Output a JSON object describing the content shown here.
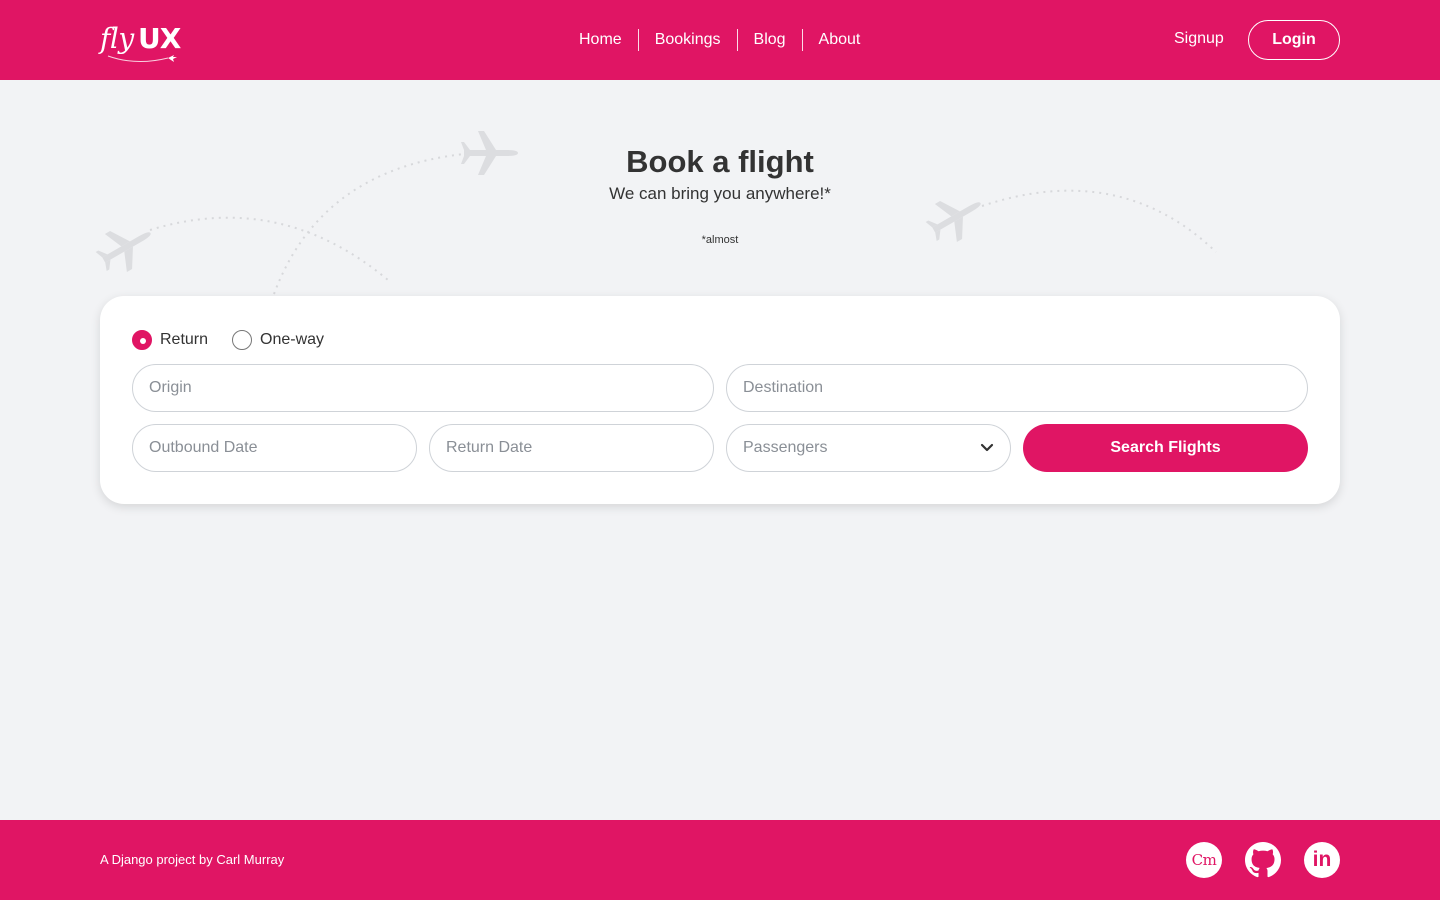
{
  "brand": {
    "logo_fly": "fly",
    "logo_ux": "UX",
    "primary_color": "#e01564"
  },
  "nav": {
    "items": [
      {
        "label": "Home"
      },
      {
        "label": "Bookings"
      },
      {
        "label": "Blog"
      },
      {
        "label": "About"
      }
    ],
    "signup_label": "Signup",
    "login_label": "Login"
  },
  "hero": {
    "title": "Book a flight",
    "subtitle": "We can bring you anywhere!*",
    "note": "*almost"
  },
  "search": {
    "trip_types": [
      {
        "label": "Return",
        "selected": true
      },
      {
        "label": "One-way",
        "selected": false
      }
    ],
    "origin_placeholder": "Origin",
    "destination_placeholder": "Destination",
    "outbound_placeholder": "Outbound Date",
    "return_placeholder": "Return Date",
    "passengers_placeholder": "Passengers",
    "submit_label": "Search Flights"
  },
  "footer": {
    "credit_prefix": "A Django project by",
    "author": "Carl Murray",
    "social": [
      {
        "name": "cm-logo-icon",
        "text": "Cm"
      },
      {
        "name": "github-icon"
      },
      {
        "name": "linkedin-icon",
        "text": "in"
      }
    ]
  }
}
